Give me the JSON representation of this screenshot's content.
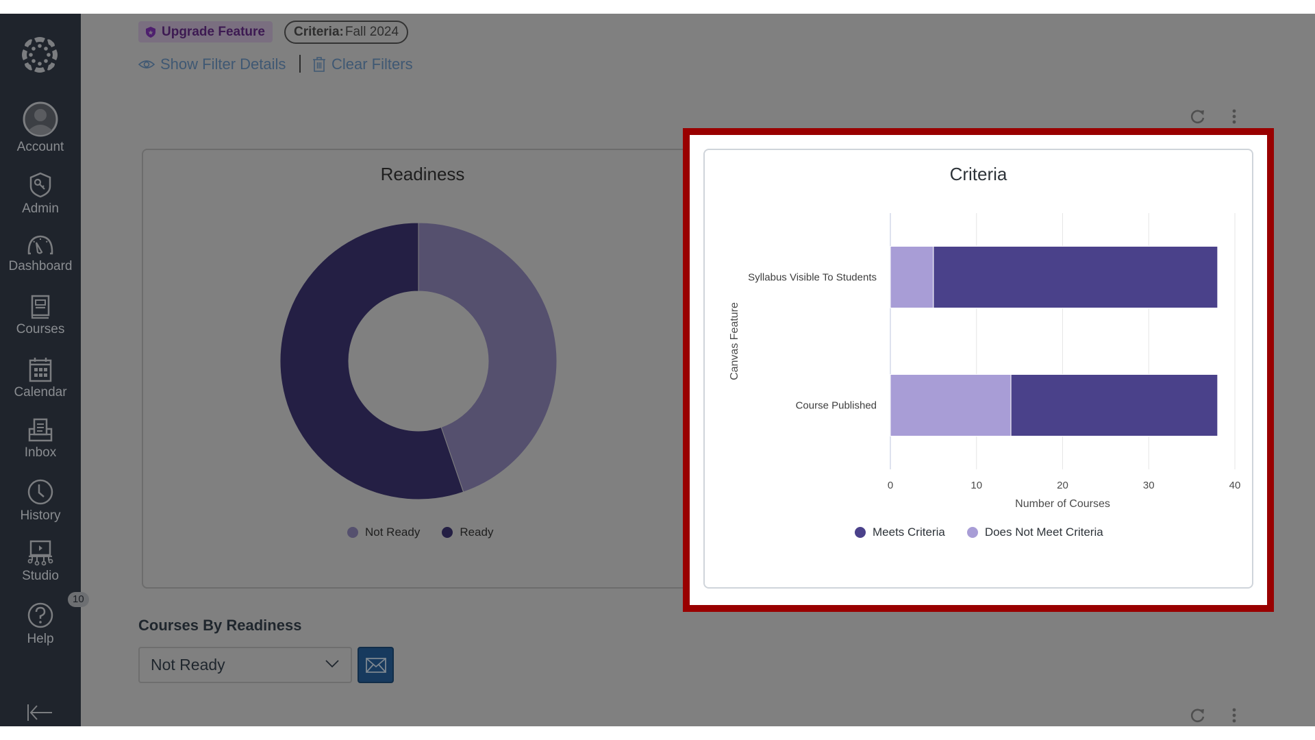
{
  "sidebar": {
    "items": [
      {
        "label": "Account",
        "icon": "account-avatar-icon"
      },
      {
        "label": "Admin",
        "icon": "admin-shield-key-icon"
      },
      {
        "label": "Dashboard",
        "icon": "dashboard-gauge-icon"
      },
      {
        "label": "Courses",
        "icon": "courses-book-icon"
      },
      {
        "label": "Calendar",
        "icon": "calendar-icon"
      },
      {
        "label": "Inbox",
        "icon": "inbox-icon"
      },
      {
        "label": "History",
        "icon": "clock-icon"
      },
      {
        "label": "Studio",
        "icon": "studio-icon"
      },
      {
        "label": "Help",
        "icon": "help-question-icon",
        "badge": "10"
      }
    ],
    "collapse_icon": "collapse-arrow-icon"
  },
  "filters": {
    "upgrade_label": "Upgrade Feature",
    "criteria_label": "Criteria:",
    "criteria_value": "Fall 2024",
    "show_details_label": "Show Filter Details",
    "clear_filters_label": "Clear Filters"
  },
  "readiness_card": {
    "title": "Readiness"
  },
  "criteria_card": {
    "title": "Criteria"
  },
  "courses_by_readiness": {
    "title": "Courses By Readiness",
    "select_value": "Not Ready"
  },
  "colors": {
    "not_ready": "#55506e",
    "ready": "#241f44",
    "meets": "#4a418a",
    "does_not_meet": "#a89dd6",
    "highlight": "#990000"
  },
  "chart_data": [
    {
      "type": "pie",
      "variant": "donut",
      "title": "Readiness",
      "categories": [
        "Not Ready",
        "Ready"
      ],
      "values": [
        17,
        21
      ],
      "legend": [
        "Not Ready",
        "Ready"
      ],
      "legend_position": "bottom"
    },
    {
      "type": "bar",
      "orientation": "horizontal",
      "stacked": true,
      "title": "Criteria",
      "categories": [
        "Syllabus Visible To Students",
        "Course Published"
      ],
      "series": [
        {
          "name": "Does Not Meet Criteria",
          "values": [
            5,
            14
          ]
        },
        {
          "name": "Meets Criteria",
          "values": [
            33,
            24
          ]
        }
      ],
      "xlabel": "Number of Courses",
      "ylabel": "Canvas Feature",
      "xlim": [
        0,
        40
      ],
      "xticks": [
        0,
        10,
        20,
        30,
        40
      ],
      "grid": true,
      "legend": [
        "Meets Criteria",
        "Does Not Meet Criteria"
      ],
      "legend_position": "bottom"
    }
  ]
}
